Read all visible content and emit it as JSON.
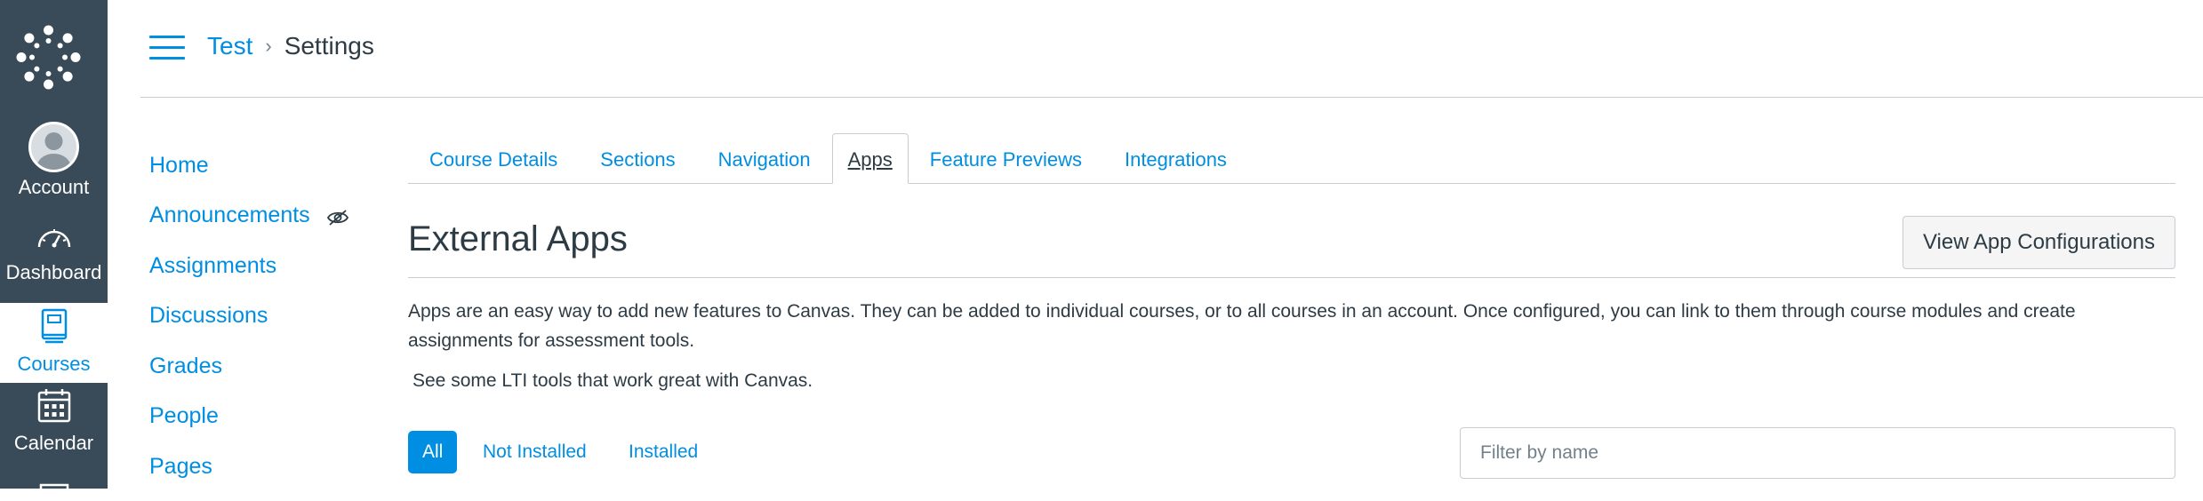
{
  "global_nav": {
    "account_label": "Account",
    "dashboard_label": "Dashboard",
    "courses_label": "Courses",
    "calendar_label": "Calendar"
  },
  "breadcrumb": {
    "course": "Test",
    "separator": ">",
    "current": "Settings"
  },
  "course_nav": {
    "items": [
      {
        "label": "Home"
      },
      {
        "label": "Announcements"
      },
      {
        "label": "Assignments"
      },
      {
        "label": "Discussions"
      },
      {
        "label": "Grades"
      },
      {
        "label": "People"
      },
      {
        "label": "Pages"
      }
    ]
  },
  "tabs": [
    {
      "label": "Course Details"
    },
    {
      "label": "Sections"
    },
    {
      "label": "Navigation"
    },
    {
      "label": "Apps"
    },
    {
      "label": "Feature Previews"
    },
    {
      "label": "Integrations"
    }
  ],
  "external_apps": {
    "title": "External Apps",
    "view_config_label": "View App Configurations",
    "description": "Apps are an easy way to add new features to Canvas. They can be added to individual courses, or to all courses in an account. Once configured, you can link to them through course modules and create assignments for assessment tools.",
    "lti_text": "See some LTI tools that work great with Canvas."
  },
  "filters": {
    "all": "All",
    "not_installed": "Not Installed",
    "installed": "Installed",
    "search_placeholder": "Filter by name"
  },
  "colors": {
    "nav_bg": "#394b58",
    "link": "#008ee2",
    "text": "#2d3b45",
    "border": "#c7cdd1"
  }
}
